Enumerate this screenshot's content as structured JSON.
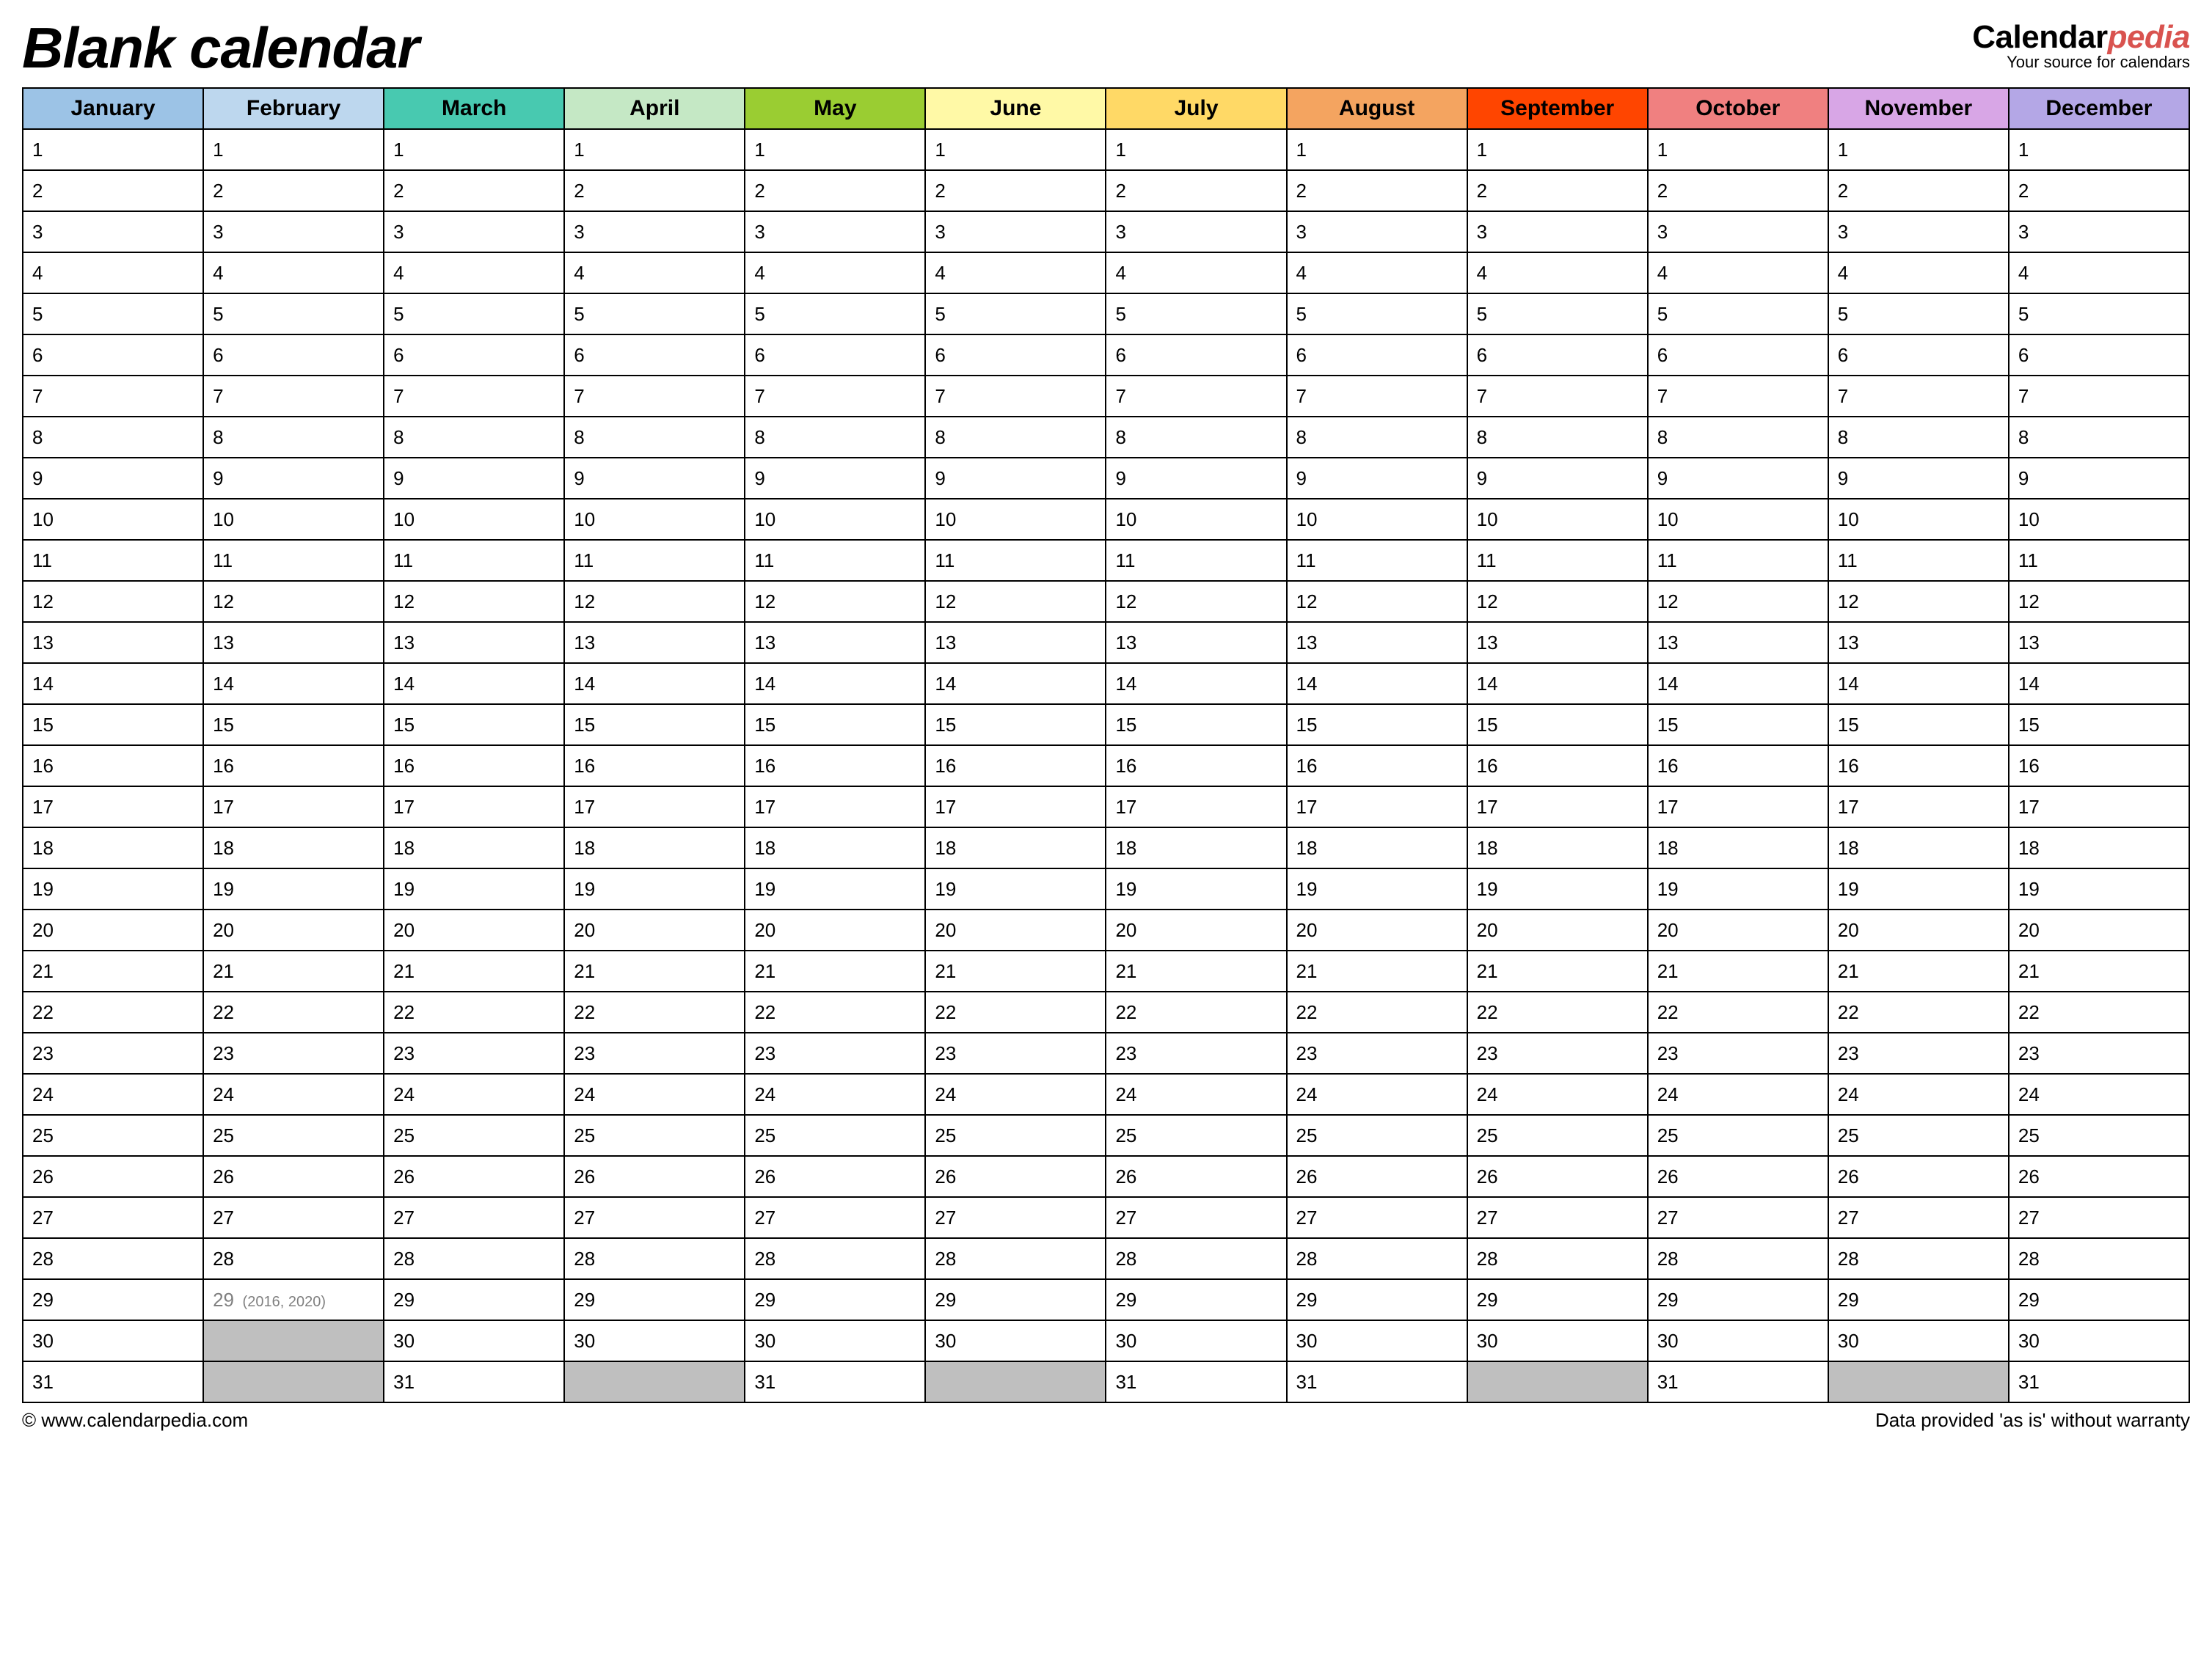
{
  "title": "Blank calendar",
  "brand": {
    "part1": "Calendar",
    "part2": "pedia",
    "tag": "Your source for calendars"
  },
  "months": [
    {
      "name": "January",
      "color": "#9cc3e6",
      "days": 31
    },
    {
      "name": "February",
      "color": "#bdd7ee",
      "days": 28,
      "leap": {
        "day": 29,
        "note": "(2016, 2020)"
      }
    },
    {
      "name": "March",
      "color": "#48c9b0",
      "days": 31
    },
    {
      "name": "April",
      "color": "#c5e8c5",
      "days": 30
    },
    {
      "name": "May",
      "color": "#9acd32",
      "days": 31
    },
    {
      "name": "June",
      "color": "#fff9a6",
      "days": 30
    },
    {
      "name": "July",
      "color": "#ffd966",
      "days": 31
    },
    {
      "name": "August",
      "color": "#f4a460",
      "days": 31
    },
    {
      "name": "September",
      "color": "#ff4500",
      "days": 30
    },
    {
      "name": "October",
      "color": "#f08080",
      "days": 31
    },
    {
      "name": "November",
      "color": "#d8a6e6",
      "days": 30
    },
    {
      "name": "December",
      "color": "#b4a7e6",
      "days": 31
    }
  ],
  "max_rows": 31,
  "footer": {
    "left": "© www.calendarpedia.com",
    "right": "Data provided 'as is' without warranty"
  }
}
